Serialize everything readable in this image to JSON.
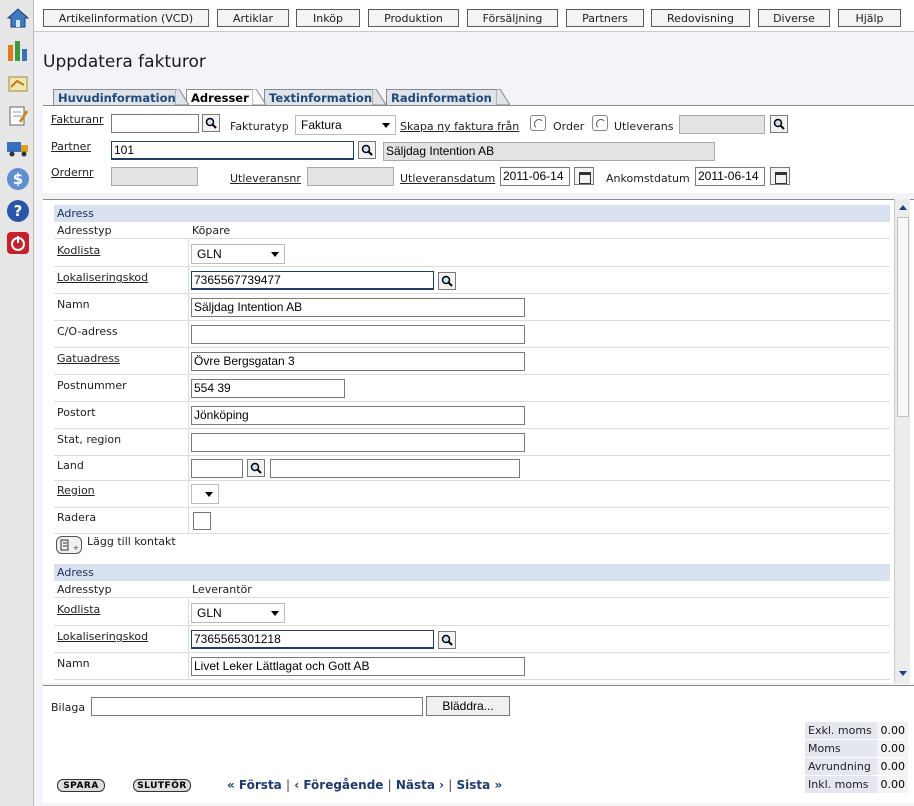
{
  "left_toolbar": [
    "home-icon",
    "chart-icon",
    "handshake-icon",
    "edit-note-icon",
    "truck-icon",
    "dollar-icon",
    "help-icon",
    "power-icon"
  ],
  "top_menu": [
    "Artikelinformation (VCD)",
    "Artiklar",
    "Inköp",
    "Produktion",
    "Försäljning",
    "Partners",
    "Redovisning",
    "Diverse",
    "Hjälp"
  ],
  "page_title": "Uppdatera fakturor",
  "tabs": [
    "Huvudinformation",
    "Adresser",
    "Textinformation",
    "Radinformation"
  ],
  "header": {
    "fakturanr_label": "Fakturanr",
    "fakturanr_value": "",
    "fakturatyp_label": "Fakturatyp",
    "fakturatyp_value": "Faktura",
    "skapa_label": "Skapa ny faktura från",
    "order_label": "Order",
    "utleverans_label": "Utleverans",
    "utleverans_value": "",
    "partner_label": "Partner",
    "partner_value": "101",
    "partner_name": "Säljdag Intention AB",
    "ordernr_label": "Ordernr",
    "ordernr_value": "",
    "utleveransnr_label": "Utleveransnr",
    "utleveransnr_value": "",
    "utleveransdatum_label": "Utleveransdatum",
    "utleveransdatum_value": "2011-06-14",
    "ankomstdatum_label": "Ankomstdatum",
    "ankomstdatum_value": "2011-06-14"
  },
  "address1": {
    "heading": "Adress",
    "adresstyp_label": "Adresstyp",
    "adresstyp_value": "Köpare",
    "kodlista_label": "Kodlista",
    "kodlista_value": "GLN",
    "lokaliseringskod_label": "Lokaliseringskod",
    "lokaliseringskod_value": "7365567739477",
    "namn_label": "Namn",
    "namn_value": "Säljdag Intention AB",
    "co_label": "C/O-adress",
    "co_value": "",
    "gatuadress_label": "Gatuadress",
    "gatuadress_value": "Övre Bergsgatan 3",
    "postnummer_label": "Postnummer",
    "postnummer_value": "554 39",
    "postort_label": "Postort",
    "postort_value": "Jönköping",
    "stat_label": "Stat, region",
    "stat_value": "",
    "land_label": "Land",
    "land_code": "",
    "land_name": "",
    "region_label": "Region",
    "region_value": "",
    "radera_label": "Radera",
    "add_contact_label": "Lägg till kontakt"
  },
  "address2": {
    "heading": "Adress",
    "adresstyp_label": "Adresstyp",
    "adresstyp_value": "Leverantör",
    "kodlista_label": "Kodlista",
    "kodlista_value": "GLN",
    "lokaliseringskod_label": "Lokaliseringskod",
    "lokaliseringskod_value": "7365565301218",
    "namn_label": "Namn",
    "namn_value": "Livet Leker Lättlagat och Gott AB"
  },
  "bottom": {
    "bilaga_label": "Bilaga",
    "bilaga_value": "",
    "browse_label": "Bläddra...",
    "spara_label": "SPARA",
    "slutfor_label": "SLUTFÖR",
    "first_label": "« Första",
    "prev_label": "‹ Föregående",
    "next_label": "Nästa ›",
    "last_label": "Sista »",
    "sep": "|"
  },
  "totals": [
    {
      "label": "Exkl. moms",
      "value": "0.00"
    },
    {
      "label": "Moms",
      "value": "0.00"
    },
    {
      "label": "Avrundning",
      "value": "0.00"
    },
    {
      "label": "Inkl. moms",
      "value": "0.00"
    }
  ],
  "colors": {
    "accent": "#214a7a",
    "section_bg": "#d9e1f1",
    "menu_border": "#5a5a5a"
  }
}
